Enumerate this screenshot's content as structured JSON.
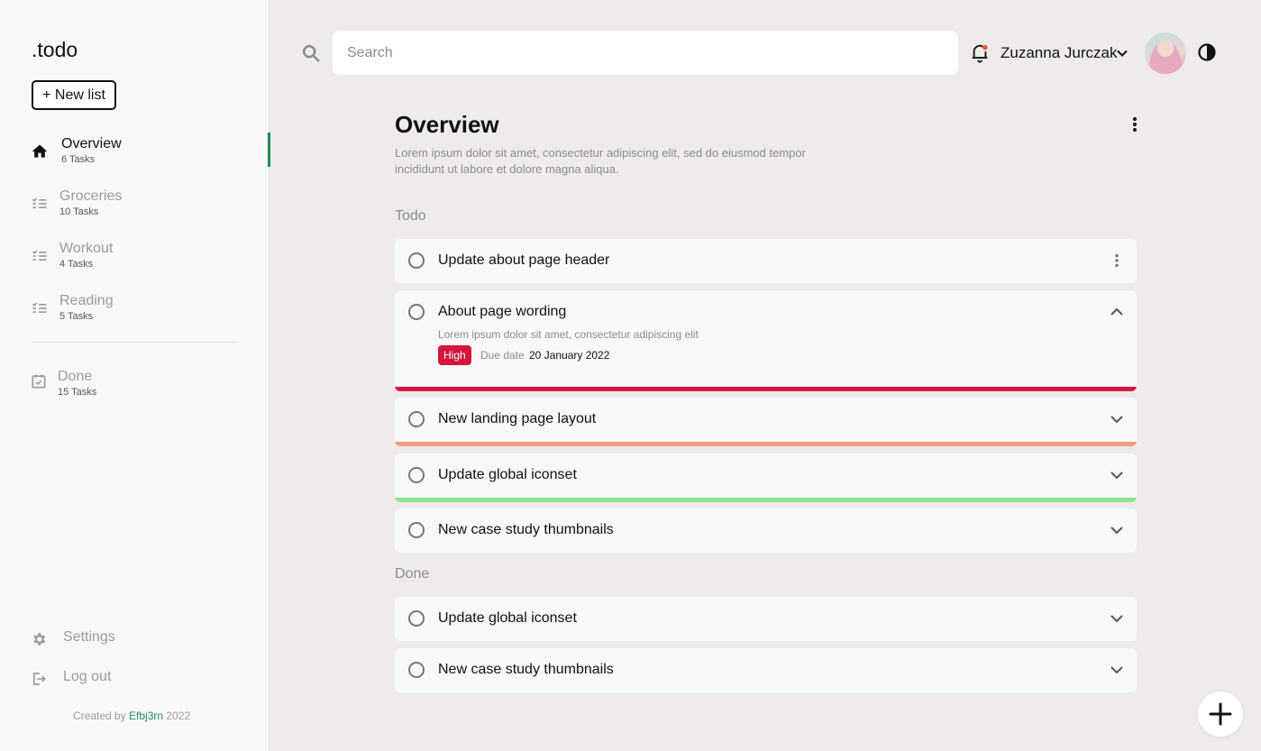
{
  "app": {
    "logo": ".todo",
    "new_list_label": "+ New list"
  },
  "sidebar": {
    "items": [
      {
        "name": "Overview",
        "count": "6 Tasks",
        "icon": "home-icon",
        "active": true
      },
      {
        "name": "Groceries",
        "count": "10 Tasks",
        "icon": "checklist-icon"
      },
      {
        "name": "Workout",
        "count": "4 Tasks",
        "icon": "checklist-icon"
      },
      {
        "name": "Reading",
        "count": "5 Tasks",
        "icon": "checklist-icon"
      }
    ],
    "done": {
      "name": "Done",
      "count": "15 Tasks",
      "icon": "calendar-check-icon"
    },
    "settings_label": "Settings",
    "logout_label": "Log out",
    "credit_prefix": "Created by",
    "credit_author": "Efbj3rn",
    "credit_year": "2022",
    "accent_color": "#1f8a5b"
  },
  "header": {
    "search_placeholder": "Search",
    "user_name": "Zuzanna Jurczak",
    "notification_dot_color": "#ef5b2a"
  },
  "main": {
    "title": "Overview",
    "description": "Lorem ipsum dolor sit amet, consectetur adipiscing elit, sed do eiusmod tempor incididunt ut labore et dolore magna aliqua.",
    "todo_label": "Todo",
    "done_label": "Done",
    "todo_tasks": [
      {
        "title": "Update about page header",
        "action": "more-icon"
      },
      {
        "title": "About page wording",
        "action": "chevron-up-icon",
        "expanded": true,
        "description": "Lorem ipsum dolor sit amet, consectetur adipiscing elit",
        "priority": "High",
        "due_label": "Due date",
        "due_date": "20 January 2022",
        "bar_color": "#d3173e"
      },
      {
        "title": "New landing page layout",
        "action": "chevron-down-icon",
        "bar_color": "#f39e7c"
      },
      {
        "title": "Update global iconset",
        "action": "chevron-down-icon",
        "bar_color": "#8fe28f"
      },
      {
        "title": "New case study thumbnails",
        "action": "chevron-down-icon"
      }
    ],
    "done_tasks": [
      {
        "title": "Update global iconset",
        "action": "chevron-down-icon"
      },
      {
        "title": "New case study thumbnails",
        "action": "chevron-down-icon"
      }
    ],
    "priority_color": "#d3173e"
  },
  "fab": {
    "icon": "plus-icon"
  }
}
